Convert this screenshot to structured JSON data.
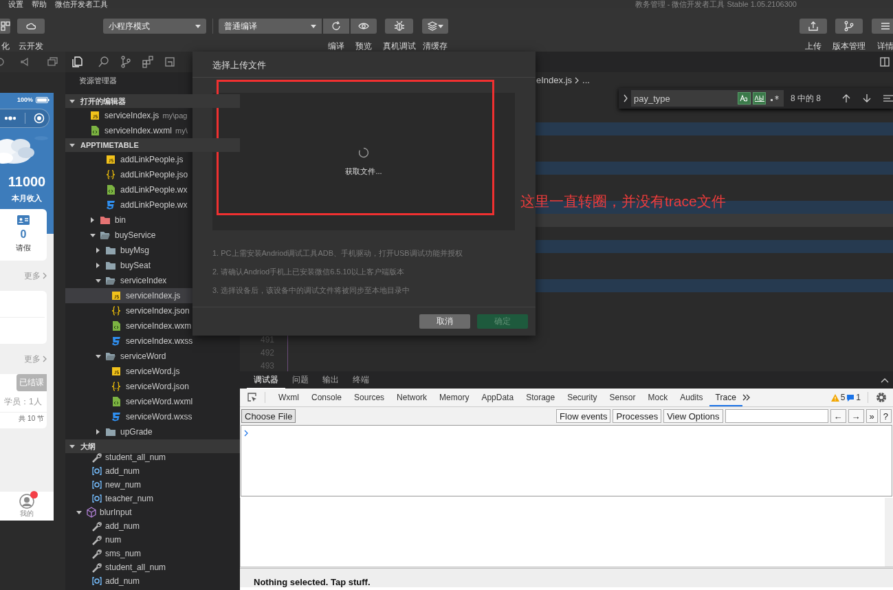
{
  "title_bar": {
    "menus": [
      "设置",
      "帮助",
      "微信开发者工具"
    ],
    "title": "教务管理 - 微信开发者工具 Stable 1.05.2106300"
  },
  "toolbar": {
    "left_buttons": [
      {
        "label": "化"
      },
      {
        "label": "云开发"
      }
    ],
    "mode_select": "小程序模式",
    "compile_select": "普通编译",
    "actions": [
      {
        "label": "编译"
      },
      {
        "label": "预览"
      },
      {
        "label": "真机调试"
      },
      {
        "label": "清缓存"
      }
    ],
    "right_buttons": [
      {
        "label": "上传"
      },
      {
        "label": "版本管理"
      },
      {
        "label": "详情"
      }
    ]
  },
  "simulator": {
    "battery": "100%",
    "income": "11000",
    "income_label": "本月收入",
    "leave_count": "0",
    "leave_label": "请假",
    "more_links": [
      "更多",
      "更多"
    ],
    "course_status": "已结课",
    "students": "学员：1人",
    "lessons": "共 10 节",
    "tab_label": "我的",
    "tab_badge": true
  },
  "explorer": {
    "title": "资源管理器",
    "open_editors": {
      "title": "打开的编辑器",
      "expanded": true,
      "files": [
        {
          "name": "serviceIndex.js",
          "path": "my\\pag",
          "kind": "js"
        },
        {
          "name": "serviceIndex.wxml",
          "path": "my\\",
          "kind": "wxml"
        }
      ]
    },
    "project": {
      "title": "APPTIMETABLE",
      "expanded": true,
      "items": [
        {
          "kind": "continuation",
          "children": [
            {
              "kind": "js",
              "name": "addLinkPeople.js",
              "selected": false
            },
            {
              "kind": "json",
              "name": "addLinkPeople.jso",
              "selected": false
            },
            {
              "kind": "wxml",
              "name": "addLinkPeople.wx",
              "selected": false
            },
            {
              "kind": "wxss",
              "name": "addLinkPeople.wx",
              "selected": false
            }
          ]
        },
        {
          "kind": "special_folder",
          "name": "bin",
          "expanded": false,
          "selected": false
        },
        {
          "kind": "folder",
          "name": "buyService",
          "expanded": true,
          "selected": false,
          "children": [
            {
              "kind": "folder",
              "name": "buyMsg",
              "expanded": false,
              "selected": false
            },
            {
              "kind": "folder",
              "name": "buySeat",
              "expanded": false,
              "selected": false
            },
            {
              "kind": "folder",
              "name": "serviceIndex",
              "expanded": true,
              "selected": false,
              "children": [
                {
                  "kind": "js",
                  "name": "serviceIndex.js",
                  "selected": true
                },
                {
                  "kind": "json",
                  "name": "serviceIndex.json",
                  "selected": false
                },
                {
                  "kind": "wxml",
                  "name": "serviceIndex.wxm",
                  "selected": false
                },
                {
                  "kind": "wxss",
                  "name": "serviceIndex.wxss",
                  "selected": false
                }
              ]
            },
            {
              "kind": "folder",
              "name": "serviceWord",
              "expanded": true,
              "selected": false,
              "children": [
                {
                  "kind": "js",
                  "name": "serviceWord.js",
                  "selected": false
                },
                {
                  "kind": "json",
                  "name": "serviceWord.json",
                  "selected": false
                },
                {
                  "kind": "wxml",
                  "name": "serviceWord.wxml",
                  "selected": false
                },
                {
                  "kind": "wxss",
                  "name": "serviceWord.wxss",
                  "selected": false
                }
              ]
            },
            {
              "kind": "folder",
              "name": "upGrade",
              "expanded": false,
              "selected": false
            }
          ]
        }
      ]
    },
    "outline": {
      "title": "大纲",
      "expanded": true,
      "items": [
        {
          "kind": "continuation",
          "children": [
            {
              "kind": "property",
              "name": "student_all_num"
            },
            {
              "kind": "field",
              "name": "add_num"
            },
            {
              "kind": "field",
              "name": "new_num"
            },
            {
              "kind": "field",
              "name": "teacher_num"
            }
          ]
        },
        {
          "kind": "class",
          "name": "blurInput",
          "expanded": true,
          "children": [
            {
              "kind": "property",
              "name": "add_num"
            },
            {
              "kind": "property",
              "name": "num"
            },
            {
              "kind": "property",
              "name": "sms_num"
            },
            {
              "kind": "property",
              "name": "student_all_num"
            },
            {
              "kind": "field",
              "name": "add_num"
            }
          ]
        }
      ]
    }
  },
  "editor": {
    "breadcrumb": "eIndex.js",
    "breadcrumb_more": "...",
    "find": {
      "query": "pay_type",
      "match_case": true,
      "whole_word": true,
      "regex": false,
      "count": "8 中的 8"
    },
    "rows": [
      {
        "matched": false,
        "current": false
      },
      {
        "matched": false,
        "current": false
      },
      {
        "matched": true,
        "current": false
      },
      {
        "matched": false,
        "current": false
      },
      {
        "matched": false,
        "current": false
      },
      {
        "matched": true,
        "current": false
      },
      {
        "matched": false,
        "current": false
      },
      {
        "matched": false,
        "current": false
      },
      {
        "matched": true,
        "current": false
      },
      {
        "matched": false,
        "current": true
      },
      {
        "matched": false,
        "current": false
      },
      {
        "matched": true,
        "current": false
      },
      {
        "matched": false,
        "current": false
      },
      {
        "matched": false,
        "current": false
      },
      {
        "matched": true,
        "current": false
      },
      {
        "matched": false,
        "current": false
      },
      {
        "matched": false,
        "current": false
      },
      {
        "matched": false,
        "current": false
      },
      {
        "matched": false,
        "current": false,
        "number": "491"
      },
      {
        "matched": false,
        "current": false,
        "number": "492"
      },
      {
        "matched": false,
        "current": false,
        "number": "493"
      }
    ]
  },
  "dialog": {
    "title": "选择上传文件",
    "status": "获取文件...",
    "notes": [
      "1. PC上需安装Andriod调试工具ADB、手机驱动，打开USB调试功能并授权",
      "2. 请确认Andriod手机上已安装微信6.5.10以上客户端版本",
      "3. 选择设备后，该设备中的调试文件将被同步至本地目录中"
    ],
    "buttons": [
      {
        "label": "取消",
        "kind": "cancel",
        "disabled": false
      },
      {
        "label": "确定",
        "kind": "confirm",
        "disabled": true
      }
    ]
  },
  "annotation": {
    "note": "这里一直转圈，并没有trace文件"
  },
  "panel": {
    "tabs": [
      {
        "label": "调试器",
        "selected": true
      },
      {
        "label": "问题",
        "selected": false
      },
      {
        "label": "输出",
        "selected": false
      },
      {
        "label": "终端",
        "selected": false
      }
    ],
    "devtools": {
      "tabs": [
        {
          "label": "Wxml",
          "selected": false
        },
        {
          "label": "Console",
          "selected": false
        },
        {
          "label": "Sources",
          "selected": false
        },
        {
          "label": "Network",
          "selected": false
        },
        {
          "label": "Memory",
          "selected": false
        },
        {
          "label": "AppData",
          "selected": false
        },
        {
          "label": "Storage",
          "selected": false
        },
        {
          "label": "Security",
          "selected": false
        },
        {
          "label": "Sensor",
          "selected": false
        },
        {
          "label": "Mock",
          "selected": false
        },
        {
          "label": "Audits",
          "selected": false
        },
        {
          "label": "Trace",
          "selected": true
        }
      ],
      "warnings": "5",
      "infos": "1",
      "trace_toolbar": {
        "choose_file": "Choose File",
        "buttons": [
          "Flow events",
          "Processes",
          "View Options"
        ],
        "nav": [
          "←",
          "→",
          "»",
          "?"
        ]
      },
      "status": "Nothing selected. Tap stuff."
    }
  }
}
